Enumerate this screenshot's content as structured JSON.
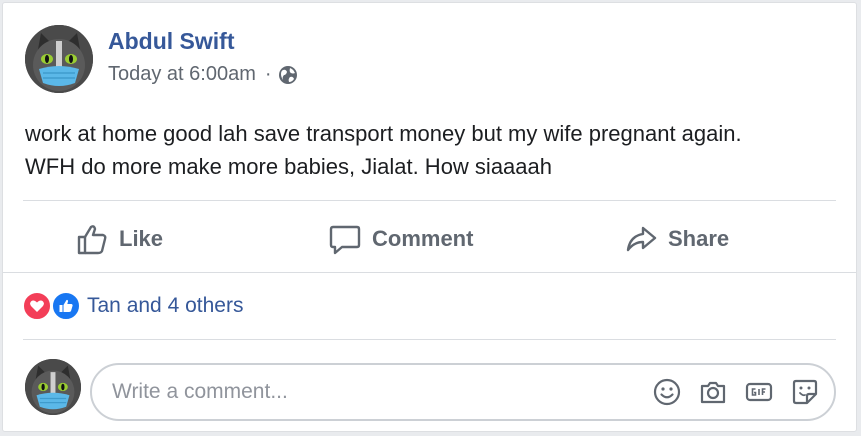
{
  "post": {
    "author_name": "Abdul Swift",
    "timestamp": "Today at 6:00am",
    "separator": "·",
    "privacy_icon": "globe-icon",
    "text_lines": [
      "work at home good lah save transport money but my wife pregnant again.",
      "WFH do more make more babies, Jialat. How siaaaah"
    ]
  },
  "actions": {
    "like_label": "Like",
    "comment_label": "Comment",
    "share_label": "Share"
  },
  "reactions": {
    "icons": [
      "love-reaction-icon",
      "like-reaction-icon"
    ],
    "summary": "Tan and 4 others"
  },
  "comment_box": {
    "placeholder": "Write a comment...",
    "value": "",
    "tools": [
      "emoji-icon",
      "camera-icon",
      "gif-icon",
      "sticker-icon"
    ]
  },
  "colors": {
    "name_link": "#365899",
    "meta_gray": "#606770",
    "love_red": "#f33e58",
    "like_blue": "#1877f2",
    "border": "#dadde1"
  }
}
